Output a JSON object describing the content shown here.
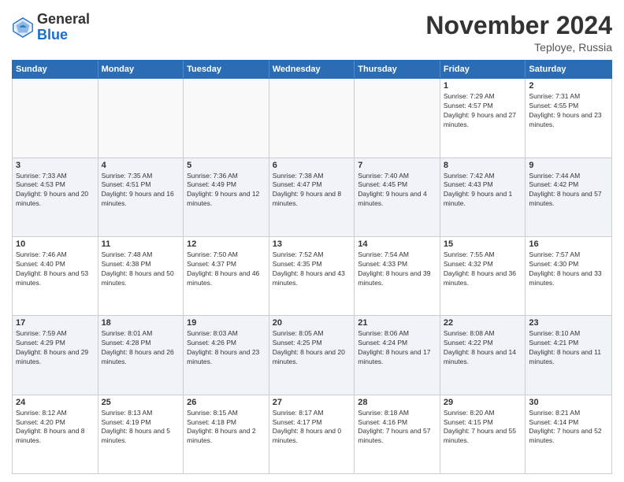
{
  "logo": {
    "general": "General",
    "blue": "Blue"
  },
  "header": {
    "month": "November 2024",
    "location": "Teploye, Russia"
  },
  "weekdays": [
    "Sunday",
    "Monday",
    "Tuesday",
    "Wednesday",
    "Thursday",
    "Friday",
    "Saturday"
  ],
  "rows": [
    [
      {
        "day": "",
        "text": "",
        "empty": true
      },
      {
        "day": "",
        "text": "",
        "empty": true
      },
      {
        "day": "",
        "text": "",
        "empty": true
      },
      {
        "day": "",
        "text": "",
        "empty": true
      },
      {
        "day": "",
        "text": "",
        "empty": true
      },
      {
        "day": "1",
        "text": "Sunrise: 7:29 AM\nSunset: 4:57 PM\nDaylight: 9 hours and 27 minutes."
      },
      {
        "day": "2",
        "text": "Sunrise: 7:31 AM\nSunset: 4:55 PM\nDaylight: 9 hours and 23 minutes."
      }
    ],
    [
      {
        "day": "3",
        "text": "Sunrise: 7:33 AM\nSunset: 4:53 PM\nDaylight: 9 hours and 20 minutes."
      },
      {
        "day": "4",
        "text": "Sunrise: 7:35 AM\nSunset: 4:51 PM\nDaylight: 9 hours and 16 minutes."
      },
      {
        "day": "5",
        "text": "Sunrise: 7:36 AM\nSunset: 4:49 PM\nDaylight: 9 hours and 12 minutes."
      },
      {
        "day": "6",
        "text": "Sunrise: 7:38 AM\nSunset: 4:47 PM\nDaylight: 9 hours and 8 minutes."
      },
      {
        "day": "7",
        "text": "Sunrise: 7:40 AM\nSunset: 4:45 PM\nDaylight: 9 hours and 4 minutes."
      },
      {
        "day": "8",
        "text": "Sunrise: 7:42 AM\nSunset: 4:43 PM\nDaylight: 9 hours and 1 minute."
      },
      {
        "day": "9",
        "text": "Sunrise: 7:44 AM\nSunset: 4:42 PM\nDaylight: 8 hours and 57 minutes."
      }
    ],
    [
      {
        "day": "10",
        "text": "Sunrise: 7:46 AM\nSunset: 4:40 PM\nDaylight: 8 hours and 53 minutes."
      },
      {
        "day": "11",
        "text": "Sunrise: 7:48 AM\nSunset: 4:38 PM\nDaylight: 8 hours and 50 minutes."
      },
      {
        "day": "12",
        "text": "Sunrise: 7:50 AM\nSunset: 4:37 PM\nDaylight: 8 hours and 46 minutes."
      },
      {
        "day": "13",
        "text": "Sunrise: 7:52 AM\nSunset: 4:35 PM\nDaylight: 8 hours and 43 minutes."
      },
      {
        "day": "14",
        "text": "Sunrise: 7:54 AM\nSunset: 4:33 PM\nDaylight: 8 hours and 39 minutes."
      },
      {
        "day": "15",
        "text": "Sunrise: 7:55 AM\nSunset: 4:32 PM\nDaylight: 8 hours and 36 minutes."
      },
      {
        "day": "16",
        "text": "Sunrise: 7:57 AM\nSunset: 4:30 PM\nDaylight: 8 hours and 33 minutes."
      }
    ],
    [
      {
        "day": "17",
        "text": "Sunrise: 7:59 AM\nSunset: 4:29 PM\nDaylight: 8 hours and 29 minutes."
      },
      {
        "day": "18",
        "text": "Sunrise: 8:01 AM\nSunset: 4:28 PM\nDaylight: 8 hours and 26 minutes."
      },
      {
        "day": "19",
        "text": "Sunrise: 8:03 AM\nSunset: 4:26 PM\nDaylight: 8 hours and 23 minutes."
      },
      {
        "day": "20",
        "text": "Sunrise: 8:05 AM\nSunset: 4:25 PM\nDaylight: 8 hours and 20 minutes."
      },
      {
        "day": "21",
        "text": "Sunrise: 8:06 AM\nSunset: 4:24 PM\nDaylight: 8 hours and 17 minutes."
      },
      {
        "day": "22",
        "text": "Sunrise: 8:08 AM\nSunset: 4:22 PM\nDaylight: 8 hours and 14 minutes."
      },
      {
        "day": "23",
        "text": "Sunrise: 8:10 AM\nSunset: 4:21 PM\nDaylight: 8 hours and 11 minutes."
      }
    ],
    [
      {
        "day": "24",
        "text": "Sunrise: 8:12 AM\nSunset: 4:20 PM\nDaylight: 8 hours and 8 minutes."
      },
      {
        "day": "25",
        "text": "Sunrise: 8:13 AM\nSunset: 4:19 PM\nDaylight: 8 hours and 5 minutes."
      },
      {
        "day": "26",
        "text": "Sunrise: 8:15 AM\nSunset: 4:18 PM\nDaylight: 8 hours and 2 minutes."
      },
      {
        "day": "27",
        "text": "Sunrise: 8:17 AM\nSunset: 4:17 PM\nDaylight: 8 hours and 0 minutes."
      },
      {
        "day": "28",
        "text": "Sunrise: 8:18 AM\nSunset: 4:16 PM\nDaylight: 7 hours and 57 minutes."
      },
      {
        "day": "29",
        "text": "Sunrise: 8:20 AM\nSunset: 4:15 PM\nDaylight: 7 hours and 55 minutes."
      },
      {
        "day": "30",
        "text": "Sunrise: 8:21 AM\nSunset: 4:14 PM\nDaylight: 7 hours and 52 minutes."
      }
    ]
  ]
}
